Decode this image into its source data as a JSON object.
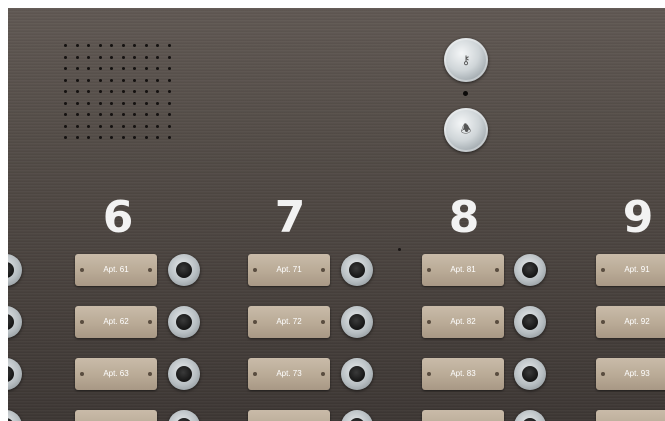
{
  "speaker": {
    "icon": "speaker-grille-icon"
  },
  "controls": {
    "key_icon": "key-icon",
    "bell_icon": "door-chime-icon"
  },
  "columns": [
    {
      "number": "6",
      "apartments": [
        "Apt. 61",
        "Apt. 62",
        "Apt. 63"
      ]
    },
    {
      "number": "7",
      "apartments": [
        "Apt. 71",
        "Apt. 72",
        "Apt. 73"
      ]
    },
    {
      "number": "8",
      "apartments": [
        "Apt. 81",
        "Apt. 82",
        "Apt. 83"
      ]
    },
    {
      "number": "9",
      "apartments": [
        "Apt. 91",
        "Apt. 92",
        "Apt. 93"
      ]
    }
  ],
  "colors": {
    "panel": "#4d4641",
    "plate": "#b9aa96",
    "digit": "#f2f2f2"
  }
}
